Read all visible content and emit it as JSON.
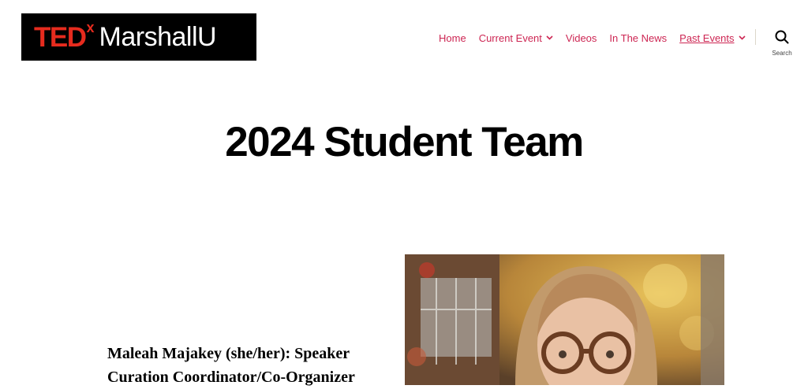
{
  "header": {
    "logo": {
      "brand": "TED",
      "superscript": "x",
      "name": "MarshallU",
      "colors": {
        "brand_red": "#e62b1e",
        "background": "#000000",
        "name_text": "#ffffff"
      }
    },
    "nav": [
      {
        "label": "Home",
        "has_dropdown": false,
        "active": false
      },
      {
        "label": "Current Event",
        "has_dropdown": true,
        "active": false
      },
      {
        "label": "Videos",
        "has_dropdown": false,
        "active": false
      },
      {
        "label": "In The News",
        "has_dropdown": false,
        "active": false
      },
      {
        "label": "Past Events",
        "has_dropdown": true,
        "active": true
      }
    ],
    "nav_color": "#cd2653",
    "search": {
      "label": "Search",
      "icon": "search-icon"
    }
  },
  "main": {
    "title": "2024 Student Team",
    "member": {
      "name_role": "Maleah Majakey (she/her): Speaker Curation Coordinator/Co-Organizer",
      "photo": "portrait-photo"
    }
  }
}
